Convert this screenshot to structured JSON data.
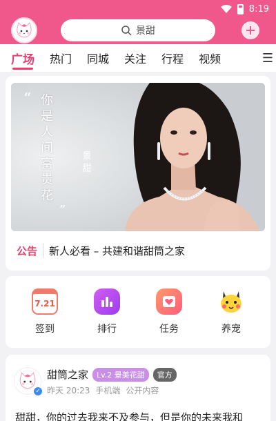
{
  "status": {
    "time": "8:19"
  },
  "header": {
    "search_placeholder": "景甜",
    "colors": {
      "bar": "#f0578a"
    }
  },
  "tabs": [
    {
      "label": "广场"
    },
    {
      "label": "热门"
    },
    {
      "label": "同城"
    },
    {
      "label": "关注"
    },
    {
      "label": "行程"
    },
    {
      "label": "视频"
    }
  ],
  "banner": {
    "quote_text": [
      "你",
      "是",
      "人",
      "间",
      "富",
      "贵",
      "花"
    ],
    "side_name": [
      "景",
      "甜"
    ]
  },
  "notice": {
    "tag": "公告",
    "text": "新人必看 – 共建和谐甜筒之家"
  },
  "shortcuts": [
    {
      "label": "签到",
      "icon": "calendar-icon",
      "date": "7.21"
    },
    {
      "label": "排行",
      "icon": "ranking-icon"
    },
    {
      "label": "任务",
      "icon": "task-icon"
    },
    {
      "label": "养宠",
      "icon": "pet-icon"
    }
  ],
  "post": {
    "author": "甜筒之家",
    "level_badge": "Lv.2 景美花甜",
    "official_badge": "官方",
    "time": "昨天 20:23",
    "device": "手机端",
    "visibility": "公开内容",
    "body": "甜甜，你的过去我来不及参与，但是你的未来我和"
  }
}
